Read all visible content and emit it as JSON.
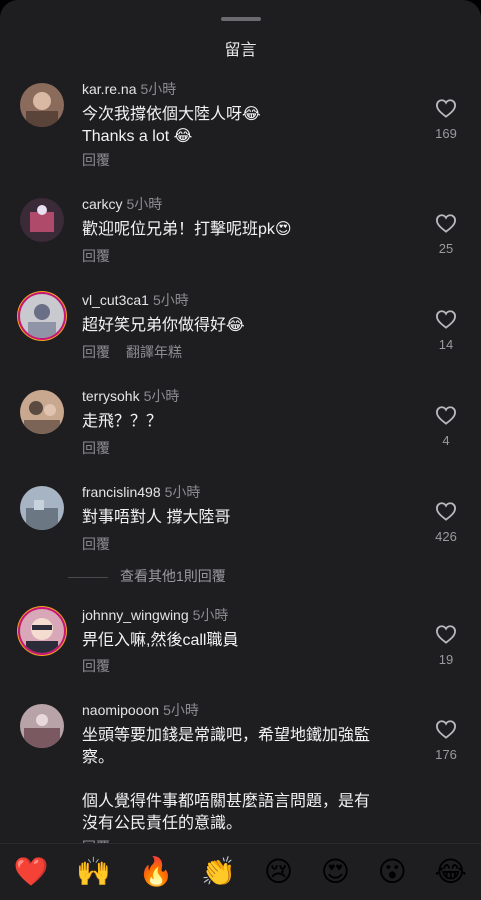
{
  "sheet": {
    "title": "留言"
  },
  "comments": [
    {
      "username": "kar.re.na",
      "time": "5小時",
      "lines": [
        "今次我撐依個大陸人呀😂",
        "Thanks a lot 😂"
      ],
      "reply": "回覆",
      "likes": "169",
      "avatar_colors": [
        "#8a6b5c",
        "#d9b8a4"
      ]
    },
    {
      "username": "carkcy",
      "time": "5小時",
      "lines": [
        "歡迎呢位兄弟！打擊呢班pk😍"
      ],
      "reply": "回覆",
      "likes": "25",
      "avatar_colors": [
        "#3b2a38",
        "#b04a6a"
      ]
    },
    {
      "username": "vl_cut3ca1",
      "time": "5小時",
      "lines": [
        "超好笑兄弟你做得好😂"
      ],
      "reply": "回覆",
      "translate": "翻譯年糕",
      "likes": "14",
      "avatar_colors": [
        "#c9c9d0",
        "#6a6f85"
      ]
    },
    {
      "username": "terrysohk",
      "time": "5小時",
      "lines": [
        "走飛？？？"
      ],
      "reply": "回覆",
      "likes": "4",
      "avatar_colors": [
        "#c9a890",
        "#5a4a40"
      ]
    },
    {
      "username": "francislin498",
      "time": "5小時",
      "lines": [
        "對事唔對人 撐大陸哥"
      ],
      "reply": "回覆",
      "likes": "426",
      "avatar_colors": [
        "#a7b4c4",
        "#6c7784"
      ]
    },
    {
      "username": "johnny_wingwing",
      "time": "5小時",
      "lines": [
        "畀佢入嘛,然後call職員"
      ],
      "reply": "回覆",
      "likes": "19",
      "avatar_colors": [
        "#d8a8b8",
        "#2b2b3a"
      ]
    },
    {
      "username": "naomipooon",
      "time": "5小時",
      "lines": [
        "坐頭等要加錢是常識吧，希望地鐵加強監",
        "察。",
        "",
        "個人覺得件事都唔關甚麼語言問題，是有",
        "沒有公民責任的意識。"
      ],
      "reply": "回覆",
      "likes": "176",
      "avatar_colors": [
        "#b7a3a8",
        "#7a5a60"
      ]
    }
  ],
  "view_replies": "查看其他1則回覆",
  "emoji_bar": [
    "❤️",
    "🙌",
    "🔥",
    "👏",
    "😢",
    "😍",
    "😮",
    "😂"
  ]
}
